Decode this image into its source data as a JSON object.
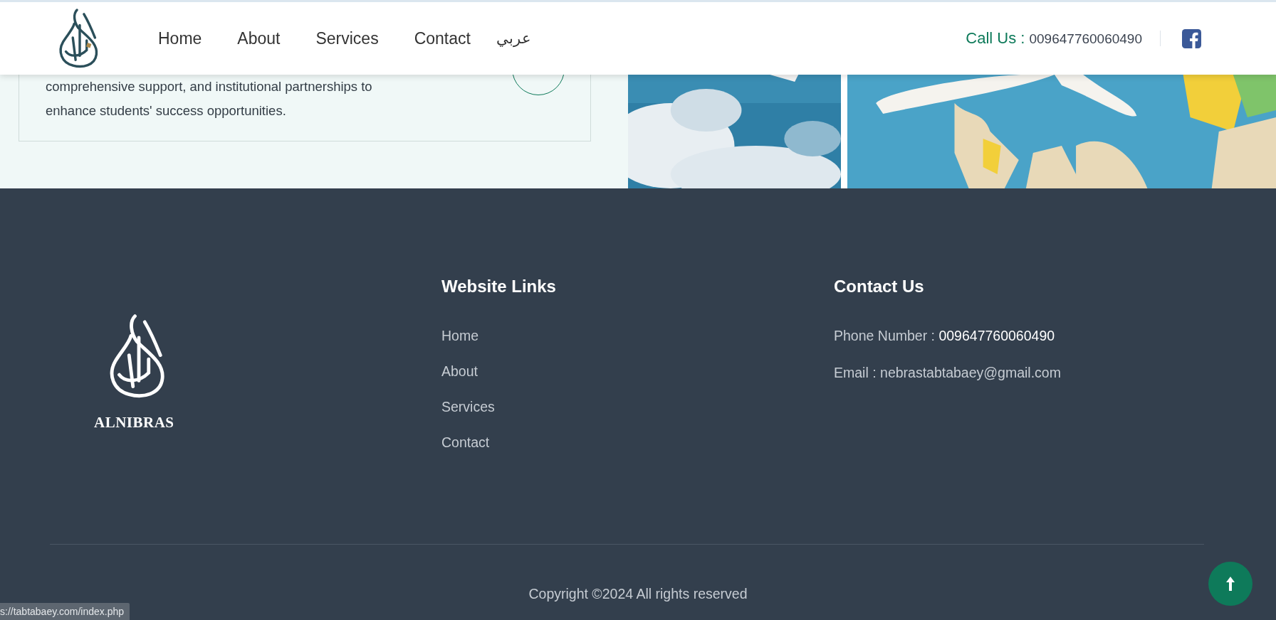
{
  "header": {
    "nav": [
      {
        "label": "Home"
      },
      {
        "label": "About"
      },
      {
        "label": "Services"
      },
      {
        "label": "Contact"
      },
      {
        "label": "عربي"
      }
    ],
    "call_label": "Call Us :",
    "phone": "009647760060490"
  },
  "intro": {
    "text": "comprehensive support, and institutional partnerships to enhance students' success opportunities."
  },
  "footer": {
    "brand": "ALNIBRAS",
    "links_title": "Website Links",
    "links": [
      {
        "label": "Home"
      },
      {
        "label": "About"
      },
      {
        "label": "Services"
      },
      {
        "label": "Contact"
      }
    ],
    "contact_title": "Contact Us",
    "contact": [
      {
        "kind": "phone",
        "label": "Phone Number :",
        "value": "009647760060490"
      },
      {
        "kind": "email",
        "label": "Email :",
        "value": "nebrastabtabaey@gmail.com"
      }
    ],
    "copyright": "Copyright ©2024 All rights reserved"
  },
  "status_bar": {
    "url": "s://tabtabaey.com/index.php"
  }
}
